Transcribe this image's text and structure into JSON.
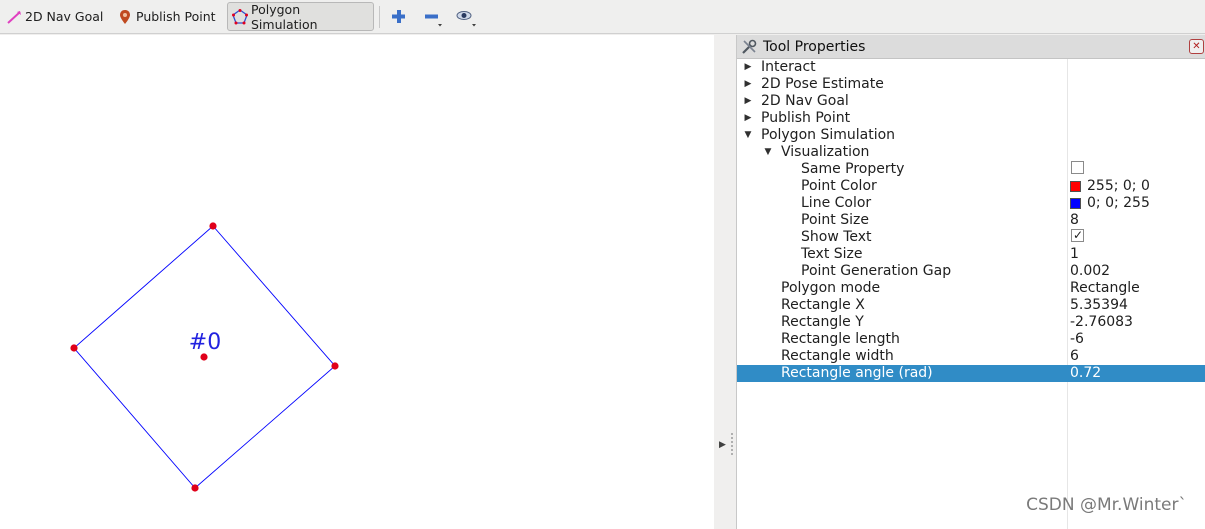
{
  "toolbar": {
    "nav_goal_label": "2D Nav Goal",
    "publish_point_label": "Publish Point",
    "polygon_sim_label": "Polygon Simulation"
  },
  "viewport": {
    "polygon_label": "#0",
    "colors": {
      "point": "#e0001a",
      "line": "#0000ff",
      "label": "#2222e0"
    }
  },
  "panel": {
    "title": "Tool Properties",
    "rows": [
      {
        "name": "Interact",
        "value": "",
        "depth": 0,
        "expander": "collapsed"
      },
      {
        "name": "2D Pose Estimate",
        "value": "",
        "depth": 0,
        "expander": "collapsed"
      },
      {
        "name": "2D Nav Goal",
        "value": "",
        "depth": 0,
        "expander": "collapsed"
      },
      {
        "name": "Publish Point",
        "value": "",
        "depth": 0,
        "expander": "collapsed"
      },
      {
        "name": "Polygon Simulation",
        "value": "",
        "depth": 0,
        "expander": "expanded"
      },
      {
        "name": "Visualization",
        "value": "",
        "depth": 1,
        "expander": "expanded"
      },
      {
        "name": "Same Property",
        "value": "",
        "depth": 2,
        "control": "checkbox",
        "checked": false
      },
      {
        "name": "Point Color",
        "value": "255; 0; 0",
        "depth": 2,
        "swatch": "#ff0000"
      },
      {
        "name": "Line Color",
        "value": "0; 0; 255",
        "depth": 2,
        "swatch": "#0000ff"
      },
      {
        "name": "Point Size",
        "value": "8",
        "depth": 2
      },
      {
        "name": "Show Text",
        "value": "",
        "depth": 2,
        "control": "checkbox",
        "checked": true
      },
      {
        "name": "Text Size",
        "value": "1",
        "depth": 2
      },
      {
        "name": "Point Generation Gap",
        "value": "0.002",
        "depth": 2
      },
      {
        "name": "Polygon mode",
        "value": "Rectangle",
        "depth": 1
      },
      {
        "name": "Rectangle X",
        "value": "5.35394",
        "depth": 1
      },
      {
        "name": "Rectangle Y",
        "value": "-2.76083",
        "depth": 1
      },
      {
        "name": "Rectangle length",
        "value": "-6",
        "depth": 1
      },
      {
        "name": "Rectangle width",
        "value": "6",
        "depth": 1
      },
      {
        "name": "Rectangle angle (rad)",
        "value": "0.72",
        "depth": 1,
        "selected": true
      }
    ]
  },
  "watermark": "CSDN @Mr.Winter`"
}
